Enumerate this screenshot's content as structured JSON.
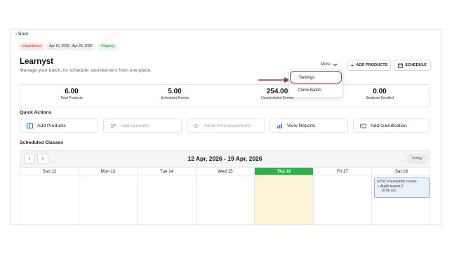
{
  "back": {
    "label": "Back"
  },
  "badges": {
    "status": "Unpublished",
    "dates": "Apr 16, 2026 - Apr 28, 2026",
    "state": "Ongoing"
  },
  "header": {
    "title": "Learnyst",
    "subtitle": "Manage your batch, its schedule, and learners from one place.",
    "more_label": "More",
    "add_products_label": "ADD PRODUCTS",
    "schedule_label": "SCHEDULE"
  },
  "dropdown": {
    "items": [
      "Settings",
      "Clone Batch"
    ]
  },
  "stats": [
    {
      "value": "6.00",
      "label": "Total Products"
    },
    {
      "value": "5.00",
      "label": "Scheduled Events"
    },
    {
      "value": "254.00",
      "label": "Unscheduled Events"
    },
    {
      "value": "0.00",
      "label": "Students Enrolled"
    }
  ],
  "quick_actions": {
    "title": "Quick Actions",
    "items": [
      {
        "label": "Add Products",
        "icon": "layout-icon"
      },
      {
        "label": "Add Learners",
        "icon": "users-icon"
      },
      {
        "label": "Send Announcements",
        "icon": "megaphone-icon"
      },
      {
        "label": "View Reports",
        "icon": "bar-chart-icon"
      },
      {
        "label": "Add Gamification",
        "icon": "gamepad-icon"
      }
    ]
  },
  "calendar": {
    "title": "Scheduled Classes",
    "range": "12 Apr, 2026 - 19 Apr, 2026",
    "today_label": "Today",
    "days": [
      "Sun 12",
      "Mon 13",
      "Tue 14",
      "Wed 15",
      "Thu 16",
      "Fri 17",
      "Sat 18"
    ],
    "event": {
      "course": "UPSC Foundation course",
      "title": "Audio lesson 2",
      "time": "10:00 am"
    }
  },
  "colors": {
    "accent_green": "#2fb04a",
    "highlight_red": "#a33a3a",
    "today_bg": "#fbf3d5"
  }
}
